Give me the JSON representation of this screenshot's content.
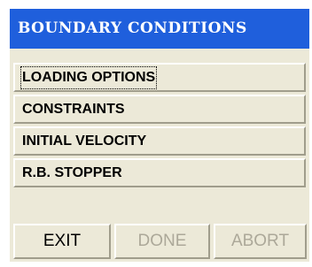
{
  "window": {
    "title": "BOUNDARY CONDITIONS"
  },
  "menu": {
    "items": [
      {
        "label": "LOADING OPTIONS"
      },
      {
        "label": "CONSTRAINTS"
      },
      {
        "label": "INITIAL VELOCITY"
      },
      {
        "label": "R.B. STOPPER"
      }
    ]
  },
  "buttons": {
    "exit_label": "EXIT",
    "done_label": "DONE",
    "abort_label": "ABORT"
  },
  "colors": {
    "titlebar": "#1f5fdc",
    "panel": "#ece9d8",
    "disabled_text": "#aca899"
  }
}
